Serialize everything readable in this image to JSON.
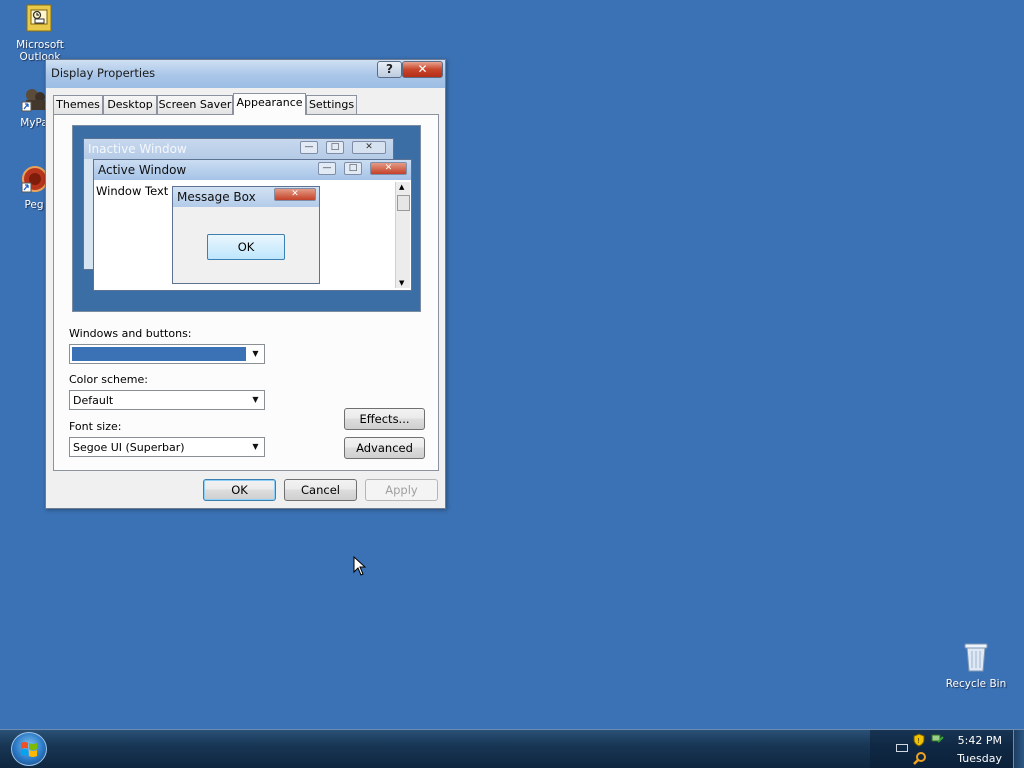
{
  "desktop": {
    "icons": [
      {
        "label": "Microsoft Outlook",
        "icon": "outlook-icon"
      },
      {
        "label": "MyPa",
        "icon": "mypa-icon"
      },
      {
        "label": "Peg",
        "icon": "peg-icon"
      },
      {
        "label": "Recycle Bin",
        "icon": "recycle-bin-icon"
      }
    ]
  },
  "dialog": {
    "title": "Display Properties",
    "help_glyph": "?",
    "close_glyph": "✕",
    "tabs": [
      {
        "label": "Themes"
      },
      {
        "label": "Desktop"
      },
      {
        "label": "Screen Saver"
      },
      {
        "label": "Appearance",
        "active": true
      },
      {
        "label": "Settings"
      }
    ],
    "preview": {
      "inactive_title": "Inactive Window",
      "active_title": "Active Window",
      "window_text": "Window Text",
      "msgbox_title": "Message Box",
      "msgbox_ok": "OK"
    },
    "windows_buttons": {
      "label": "Windows and buttons:",
      "value": ""
    },
    "color_scheme": {
      "label": "Color scheme:",
      "value": "Default"
    },
    "font_size": {
      "label": "Font size:",
      "value": "Segoe UI (Superbar)"
    },
    "effects_label": "Effects...",
    "advanced_label": "Advanced",
    "ok_label": "OK",
    "cancel_label": "Cancel",
    "apply_label": "Apply"
  },
  "taskbar": {
    "time": "5:42 PM",
    "day": "Tuesday"
  },
  "colors": {
    "desktop": "#3b72b5",
    "windows_buttons_swatch": "#3b72b5",
    "preview_bg": "#3a6ea5"
  }
}
